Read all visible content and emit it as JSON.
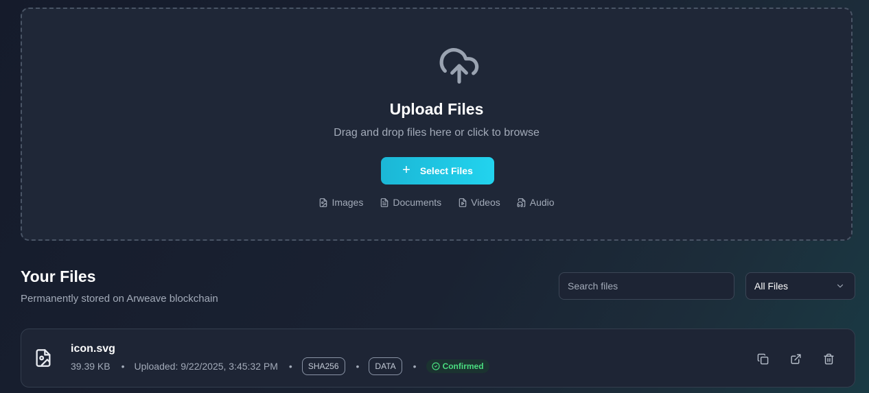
{
  "upload": {
    "title": "Upload Files",
    "subtitle": "Drag and drop files here or click to browse",
    "button_label": "Select Files",
    "types": [
      {
        "icon": "image-file-icon",
        "label": "Images"
      },
      {
        "icon": "document-file-icon",
        "label": "Documents"
      },
      {
        "icon": "video-file-icon",
        "label": "Videos"
      },
      {
        "icon": "audio-file-icon",
        "label": "Audio"
      }
    ]
  },
  "files": {
    "title": "Your Files",
    "subtitle": "Permanently stored on Arweave blockchain",
    "search_placeholder": "Search files",
    "filter_value": "All Files",
    "items": [
      {
        "name": "icon.svg",
        "size": "39.39 KB",
        "uploaded": "Uploaded: 9/22/2025, 3:45:32 PM",
        "tags": [
          "SHA256",
          "DATA"
        ],
        "status": "Confirmed"
      }
    ]
  },
  "colors": {
    "accent": "#22d3ee",
    "confirmed": "#4ade80",
    "background": "#1a2232"
  }
}
